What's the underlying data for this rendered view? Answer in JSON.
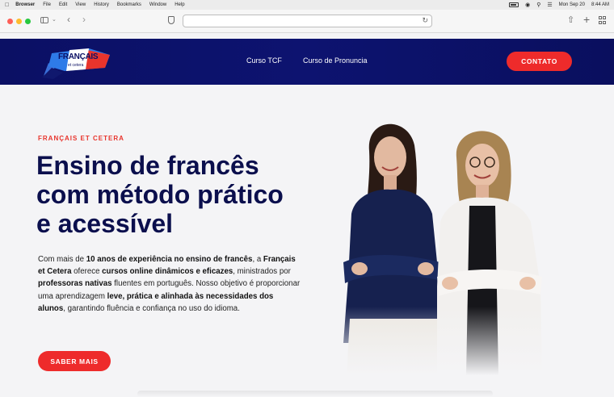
{
  "menubar": {
    "app": "Browser",
    "items": [
      "File",
      "Edit",
      "View",
      "History",
      "Bookmarks",
      "Window",
      "Help"
    ],
    "datetime": "Mon Sep 20",
    "time": "8:44 AM"
  },
  "site": {
    "logo_text": "FRANÇAIS",
    "logo_subtext": "et cetera",
    "nav": [
      "Curso TCF",
      "Curso de Pronuncia"
    ],
    "contact_label": "CONTATO"
  },
  "hero": {
    "eyebrow": "FRANÇAIS ET CETERA",
    "headline": "Ensino de francês com método prático e acessível",
    "body": {
      "p1": "Com mais de ",
      "b1": "10 anos de experiência no ensino de francês",
      "p2": ", a ",
      "b2": "Français et Cetera",
      "p3": " oferece ",
      "b3": "cursos online dinâmicos e eficazes",
      "p4": ", ministrados por ",
      "b4": "professoras nativas",
      "p5": " fluentes em português. Nosso objetivo é proporcionar uma aprendizagem ",
      "b5": "leve, prática e alinhada às necessidades dos alunos",
      "p6": ", garantindo fluência e confiança no uso do idioma."
    },
    "cta_label": "SABER MAIS"
  },
  "colors": {
    "header_bg": "#0b1064",
    "accent_red": "#ee2b2b",
    "headline": "#0b0f4d"
  }
}
